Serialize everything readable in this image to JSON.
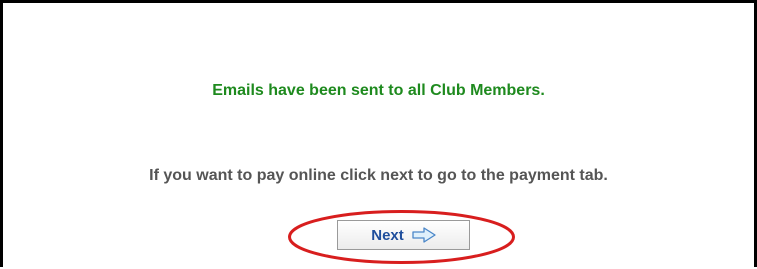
{
  "messages": {
    "success": "Emails have been sent to all Club Members.",
    "info": "If you want to pay online click next to go to the payment tab."
  },
  "next_button": {
    "label": "Next",
    "icon": "right-arrow-icon"
  },
  "colors": {
    "success_text": "#1e8a1e",
    "info_text": "#555555",
    "button_text": "#1f4e9c",
    "annotation_ellipse": "#d81e1e",
    "frame_border": "#000000"
  }
}
